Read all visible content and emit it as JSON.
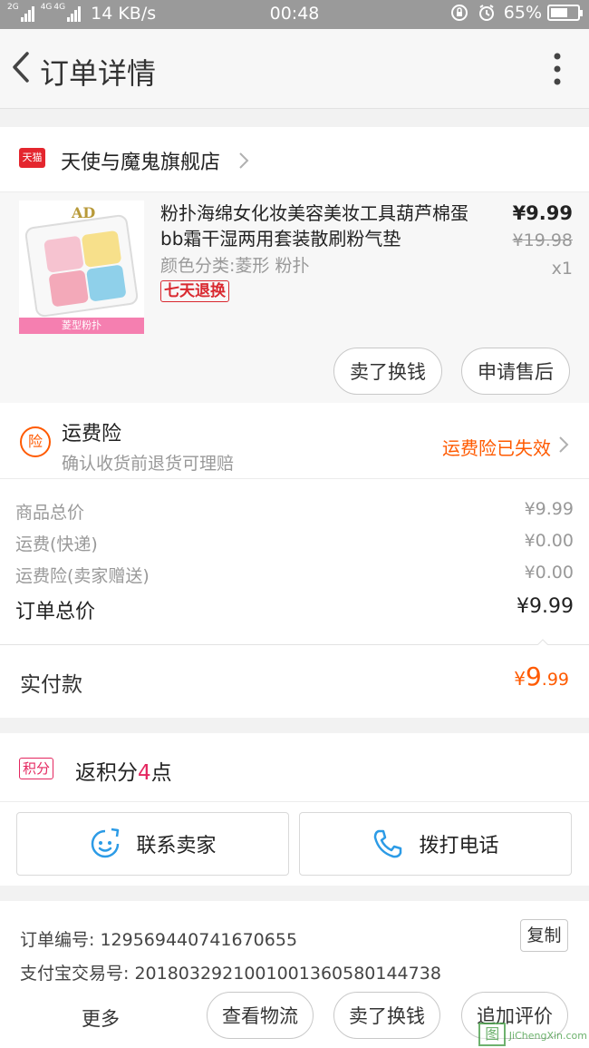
{
  "status_bar": {
    "net_tags": [
      "2G",
      "4G",
      "4G"
    ],
    "speed": "14 KB/s",
    "time": "00:48",
    "battery": "65%",
    "battery_level": 0.65,
    "icons": [
      "lock-rotation-icon",
      "alarm-icon",
      "battery-icon"
    ]
  },
  "header": {
    "title": "订单详情",
    "back_icon": "chevron-left-icon",
    "more_icon": "more-vertical-icon"
  },
  "shop": {
    "badge": "天猫",
    "name": "天使与魔鬼旗舰店"
  },
  "product": {
    "image_brand": "AD",
    "image_caption": "菱型粉扑",
    "title": "粉扑海绵女化妆美容美妆工具葫芦棉蛋bb霜干湿两用套装散刷粉气垫",
    "spec": "颜色分类:菱形 粉扑",
    "service_tag": "七天退换",
    "price": "¥9.99",
    "original_price": "¥19.98",
    "quantity": "x1",
    "buttons": [
      "卖了换钱",
      "申请售后"
    ]
  },
  "insurance": {
    "icon_text": "险",
    "title": "运费险",
    "subtitle": "确认收货前退货可理赔",
    "status": "运费险已失效"
  },
  "summary": {
    "rows": [
      {
        "label": "商品总价",
        "value": "¥9.99"
      },
      {
        "label": "运费(快递)",
        "value": "¥0.00"
      },
      {
        "label": "运费险(卖家赠送)",
        "value": "¥0.00"
      }
    ],
    "total_label": "订单总价",
    "total_value": "¥9.99"
  },
  "paid": {
    "label": "实付款",
    "currency": "¥",
    "integer": "9",
    "decimal": ".99"
  },
  "points": {
    "badge": "积分",
    "prefix": "返积分",
    "count": "4",
    "suffix": "点"
  },
  "contact": {
    "seller": "联系卖家",
    "call": "拨打电话"
  },
  "order_info": {
    "order_no": "订单编号: 129569440741670655",
    "alipay_no": "支付宝交易号: 2018032921001001360580144738",
    "copy": "复制"
  },
  "bottom_bar": {
    "more": "更多",
    "buttons": [
      "查看物流",
      "卖了换钱",
      "追加评价"
    ]
  },
  "watermark": {
    "text": "JiChengXin.com",
    "mark": "图"
  },
  "colors": {
    "accent_orange": "#ff5a00",
    "tmall_red": "#e4262e",
    "points_pink": "#e4265f",
    "contact_blue": "#2c9be6"
  }
}
